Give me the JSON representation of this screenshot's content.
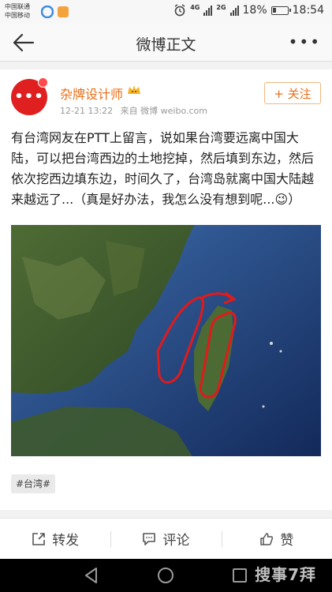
{
  "status_bar": {
    "carrier_1": "中国联通",
    "carrier_2": "中国移动",
    "network_1": "4G",
    "network_2": "2G",
    "battery": "18%",
    "time": "18:54"
  },
  "nav": {
    "title": "微博正文",
    "more": "•••"
  },
  "post": {
    "username": "杂牌设计师",
    "date": "12-21 13:22",
    "source": "来自 微博 weibo.com",
    "follow_label": "+ 关注",
    "text": "有台湾网友在PTT上留言，说如果台湾要远离中国大陆，可以把台湾西边的土地挖掉，然后填到东边，然后依次挖西边填东边，时间久了，台湾岛就离中国大陆越来越远了...（真是好办法，我怎么没有想到呢...😉）",
    "hashtag": "#台湾#"
  },
  "actions": {
    "repost": "转发",
    "comment": "评论",
    "like": "赞"
  },
  "watermark": "搜事7拜",
  "colors": {
    "accent_orange": "#e86f1a",
    "avatar_red": "#e02020",
    "annotation_red": "#e11a1a"
  }
}
